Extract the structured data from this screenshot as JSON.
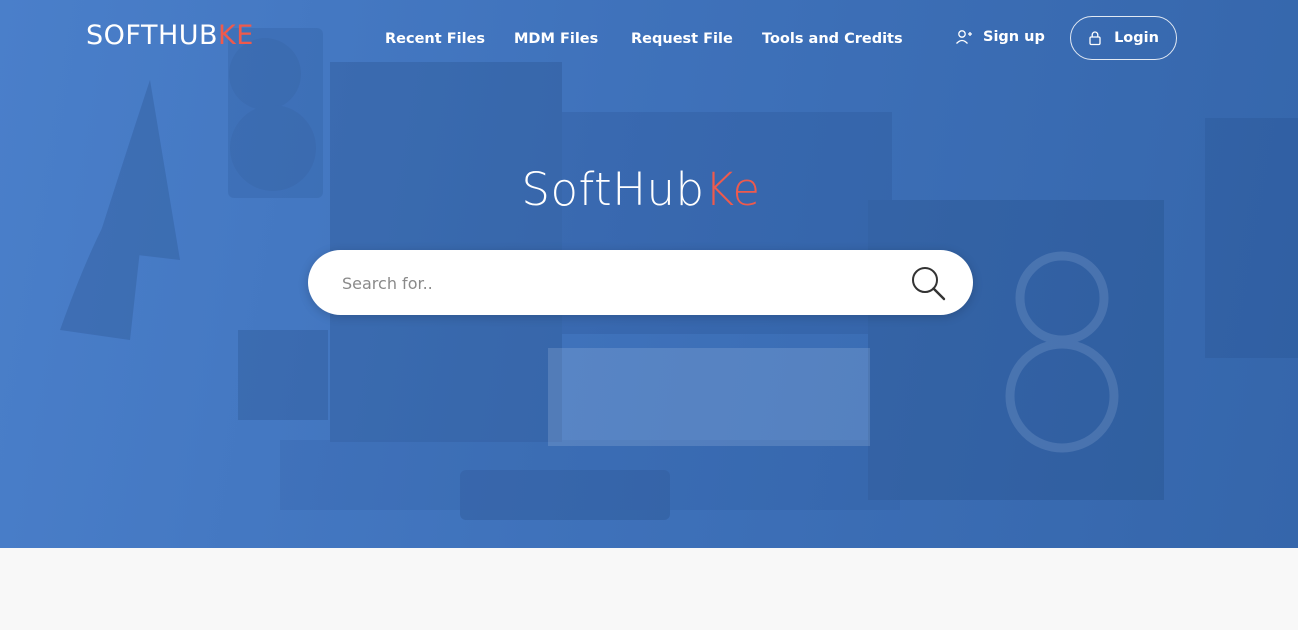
{
  "brand": {
    "logo_main": "SOFTHUB",
    "logo_accent": "KE",
    "accent_color": "#ef5a4c"
  },
  "nav": {
    "items": [
      {
        "label": "Recent Files"
      },
      {
        "label": "MDM Files"
      },
      {
        "label": "Request File"
      },
      {
        "label": "Tools and Credits"
      }
    ],
    "signup_label": "Sign up",
    "signup_icon": "user-plus-icon",
    "login_label": "Login",
    "login_icon": "lock-icon"
  },
  "hero": {
    "title_main": "SoftHub",
    "title_accent": "Ke",
    "background_color": "#3f72bb",
    "search": {
      "placeholder": "Search for..",
      "value": "",
      "icon": "search-icon"
    }
  }
}
